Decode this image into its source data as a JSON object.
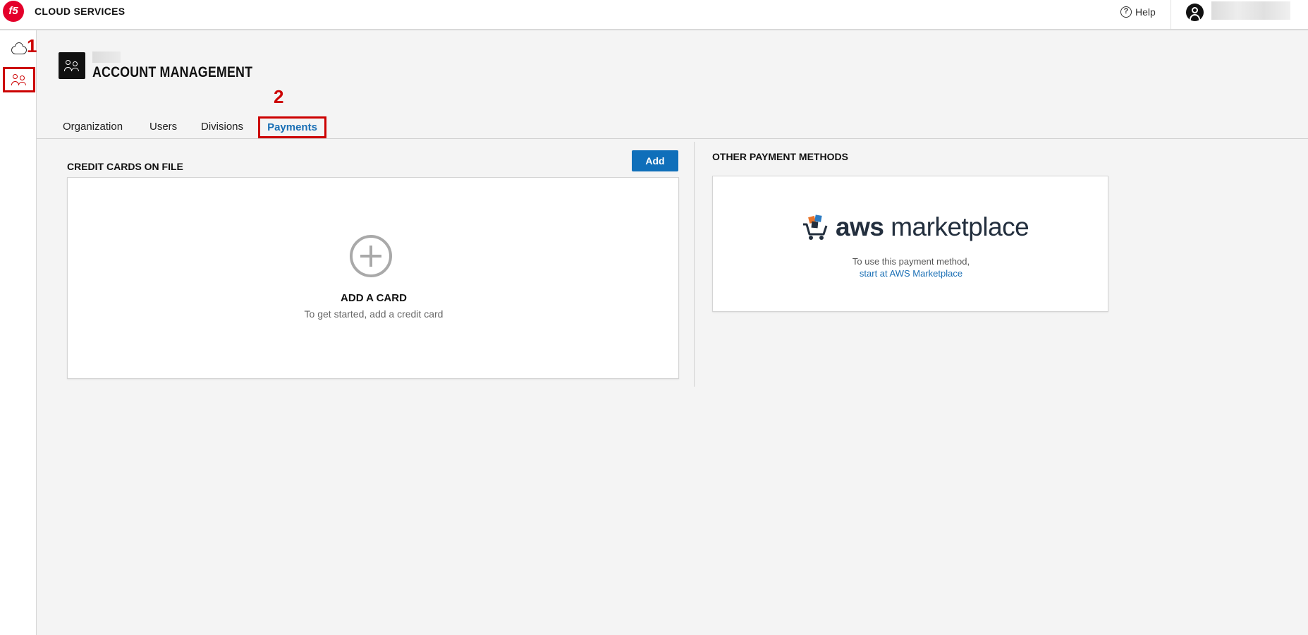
{
  "header": {
    "logo_text": "f5",
    "app_title": "CLOUD SERVICES",
    "help_label": "Help",
    "help_icon": "question-circle-icon"
  },
  "sidebar": {
    "items": [
      {
        "icon": "cloud-icon"
      },
      {
        "icon": "users-icon"
      }
    ]
  },
  "annotations": {
    "first": "1",
    "second": "2",
    "color": "#cc0000"
  },
  "page": {
    "title": "ACCOUNT MANAGEMENT"
  },
  "tabs": [
    {
      "label": "Organization"
    },
    {
      "label": "Users"
    },
    {
      "label": "Divisions"
    },
    {
      "label": "Payments",
      "active": true
    }
  ],
  "credit_cards": {
    "heading": "CREDIT CARDS ON FILE",
    "add_button": "Add",
    "empty_title": "ADD A CARD",
    "empty_subtitle": "To get started, add a credit card"
  },
  "other_methods": {
    "heading": "OTHER PAYMENT METHODS",
    "logo_word_1": "aws",
    "logo_word_2": " marketplace",
    "text": "To use this payment method,",
    "link": "start at AWS Marketplace"
  },
  "colors": {
    "accent": "#0f6fba",
    "link": "#1a6fb5",
    "brand": "#e4002b"
  }
}
